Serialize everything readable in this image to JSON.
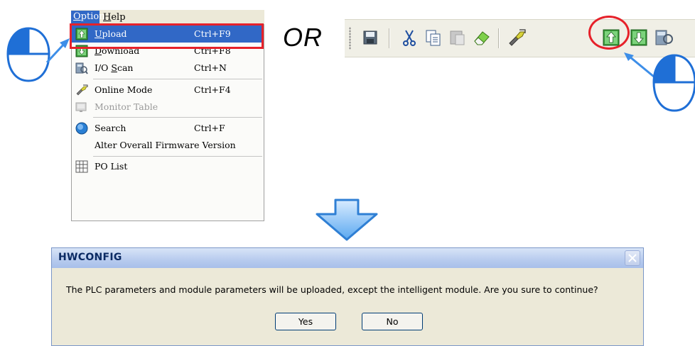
{
  "menubar": {
    "option": {
      "label": "Option",
      "underline": "O",
      "rest": "ption"
    },
    "help": {
      "label": "Help",
      "underline": "H",
      "rest": "elp"
    }
  },
  "menu": {
    "upload": {
      "u": "U",
      "rest": "pload",
      "shortcut": "Ctrl+F9",
      "icon": "upload-icon"
    },
    "download": {
      "u": "D",
      "rest": "ownload",
      "shortcut": "Ctrl+F8",
      "icon": "download-icon"
    },
    "io_scan": {
      "pre": "I/O ",
      "u": "S",
      "rest": "can",
      "shortcut": "Ctrl+N",
      "icon": "io-scan-icon"
    },
    "online_mode": {
      "label": "Online Mode",
      "shortcut": "Ctrl+F4",
      "icon": "online-mode-icon"
    },
    "monitor_table": {
      "label": "Monitor Table",
      "icon": "monitor-table-icon",
      "disabled": true
    },
    "search": {
      "label": "Search",
      "shortcut": "Ctrl+F",
      "icon": "search-icon"
    },
    "alter_firmware": {
      "label": "Alter Overall Firmware Version"
    },
    "po_list": {
      "label": "PO List",
      "icon": "po-list-icon"
    }
  },
  "or_label": "OR",
  "toolbar": {
    "buttons": [
      "save-icon",
      "cut-icon",
      "copy-icon",
      "paste-icon",
      "eraser-icon",
      "online-mode-icon",
      "upload-icon",
      "download-icon",
      "io-scan-icon"
    ]
  },
  "dialog": {
    "title": "HWCONFIG",
    "message": "The PLC parameters and module parameters will be uploaded, except the intelligent module. Are you sure to continue?",
    "yes_label": "Yes",
    "no_label": "No"
  },
  "colors": {
    "highlight_red": "#e6212a",
    "menu_selection": "#3168c6",
    "mouse_blue": "#1f6fd6",
    "arrow_blue": "#3d8ee8"
  }
}
